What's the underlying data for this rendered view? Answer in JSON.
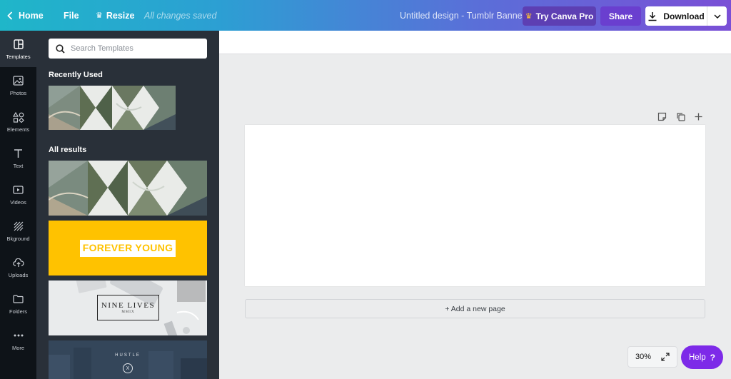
{
  "topbar": {
    "home_label": "Home",
    "file_label": "File",
    "resize_label": "Resize",
    "saved_status": "All changes saved",
    "doc_title": "Untitled design - Tumblr Banner",
    "pro_label": "Try Canva Pro",
    "share_label": "Share",
    "download_label": "Download"
  },
  "rail": {
    "items": [
      {
        "label": "Templates",
        "icon": "templates-icon"
      },
      {
        "label": "Photos",
        "icon": "photos-icon"
      },
      {
        "label": "Elements",
        "icon": "elements-icon"
      },
      {
        "label": "Text",
        "icon": "text-icon"
      },
      {
        "label": "Videos",
        "icon": "videos-icon"
      },
      {
        "label": "Bkground",
        "icon": "background-icon"
      },
      {
        "label": "Uploads",
        "icon": "uploads-icon"
      },
      {
        "label": "Folders",
        "icon": "folders-icon"
      },
      {
        "label": "More",
        "icon": "more-icon"
      }
    ]
  },
  "panel": {
    "search_placeholder": "Search Templates",
    "recent_title": "Recently Used",
    "all_title": "All results",
    "templates": [
      {
        "title": "FOREVER YOUNG"
      },
      {
        "title": "NINE LIVES",
        "subtitle": "MMIX"
      },
      {
        "title": "HUSTLE",
        "badge": "X"
      }
    ]
  },
  "workspace": {
    "add_page_label": "+ Add a new page",
    "zoom_label": "30%",
    "help_label": "Help",
    "help_mark": "?"
  },
  "colors": {
    "accent": "#7d2ae8",
    "panel": "#293039",
    "rail": "#0e1318",
    "yellow_template": "#ffc200"
  }
}
